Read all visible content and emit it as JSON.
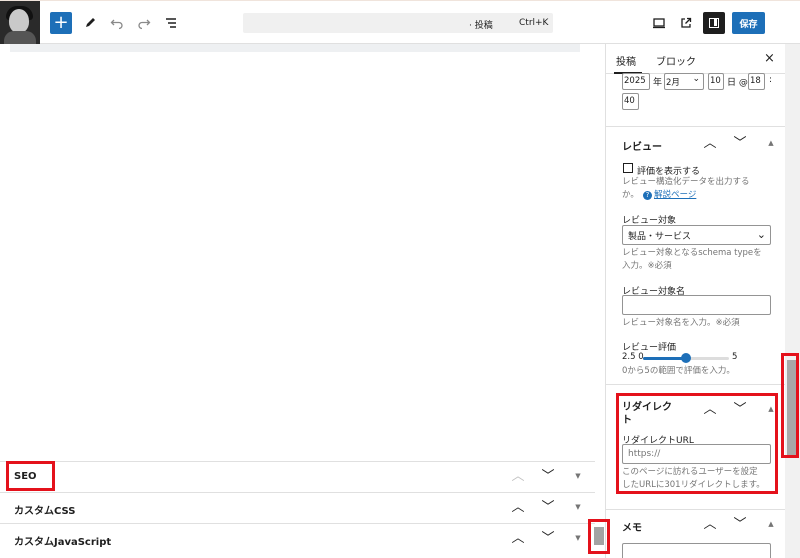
{
  "toolbar": {
    "add_label": "+",
    "edit_icon": "pencil-icon",
    "undo_icon": "undo-icon",
    "redo_icon": "redo-icon",
    "list_icon": "list-view-icon",
    "command_label": "· 投稿",
    "command_shortcut": "Ctrl+K",
    "preview_icon": "desktop-icon",
    "external_icon": "external-link-icon",
    "save_label": "保存",
    "accent_color": "#1d6fb8"
  },
  "sidebar": {
    "tab_post": "投稿",
    "tab_block": "ブロック",
    "close_label": "×",
    "date": {
      "year": "2025",
      "year_suffix": "年",
      "month": "2月",
      "day": "10",
      "day_suffix": "日 @",
      "hour": "18",
      "colon": ":",
      "minute": "40"
    },
    "review": {
      "title": "レビュー",
      "show_checkbox_label": "評価を表示する",
      "show_help_1": "レビュー構造化データを出力する",
      "show_help_2": "か。",
      "help_link": "解説ページ",
      "target_label": "レビュー対象",
      "target_value": "製品・サービス",
      "target_help_1": "レビュー対象となるschema typeを",
      "target_help_2": "入力。※必須",
      "name_label": "レビュー対象名",
      "name_value": "",
      "name_help": "レビュー対象名を入力。※必須",
      "rating_label": "レビュー評価",
      "rating_prefix": "2.5 0",
      "rating_max": "5",
      "rating_value": 2.5,
      "rating_help": "0から5の範囲で評価を入力。"
    },
    "redirect": {
      "title_1": "リダイレク",
      "title_2": "ト",
      "url_label": "リダイレクトURL",
      "url_placeholder": "https://",
      "help_1": "このページに訪れるユーザーを設定",
      "help_2": "したURLに301リダイレクトします。"
    },
    "memo": {
      "title": "メモ"
    }
  },
  "panels": {
    "seo_title": "SEO",
    "css_title": "カスタムCSS",
    "js_title": "カスタムJavaScript"
  },
  "highlight_color": "#e4111b"
}
